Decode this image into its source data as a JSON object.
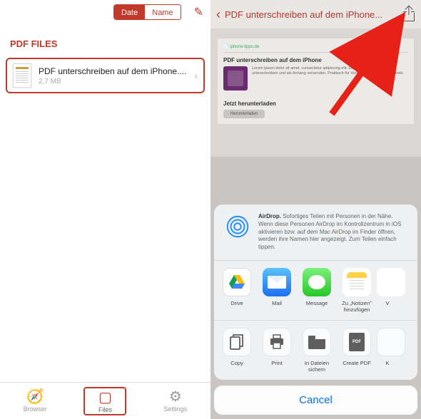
{
  "left": {
    "segmented": {
      "date": "Date",
      "name": "Name"
    },
    "section_title": "PDF FILES",
    "file": {
      "name": "PDF unterschreiben auf dem iPhone....",
      "size": "2,7 MB"
    },
    "tabs": {
      "browser": "Browser",
      "files": "Files",
      "settings": "Settings"
    }
  },
  "right": {
    "title": "PDF unterschreiben auf dem iPhone...",
    "preview": {
      "url": "📄 iphone-tipps.de",
      "heading": "PDF unterschreiben auf dem iPhone",
      "body": "Lorem ipsum dolor sit amet, consectetur adipiscing elit. Donec auf dem iPhone unterschreiben und als Anhang versenden. Praktisch für Verträge und Formulare direkt.",
      "sub_heading": "Jetzt herunterladen",
      "button": "Herunterladen"
    },
    "sheet": {
      "airdrop_bold": "AirDrop.",
      "airdrop_text": " Sofortiges Teilen mit Personen in der Nähe. Wenn diese Personen AirDrop im Kontrollzentrum in iOS aktivieren bzw. auf dem Mac AirDrop im Finder öffnen, werden ihre Namen hier angezeigt. Zum Teilen einfach tippen.",
      "apps": {
        "drive": "Drive",
        "mail": "Mail",
        "message": "Message",
        "notes": "Zu „Notizen\" hinzufügen",
        "more": "V"
      },
      "actions": {
        "copy": "Copy",
        "print": "Print",
        "files": "In Dateien sichern",
        "pdf": "Create PDF",
        "more": "K"
      },
      "cancel": "Cancel"
    }
  }
}
